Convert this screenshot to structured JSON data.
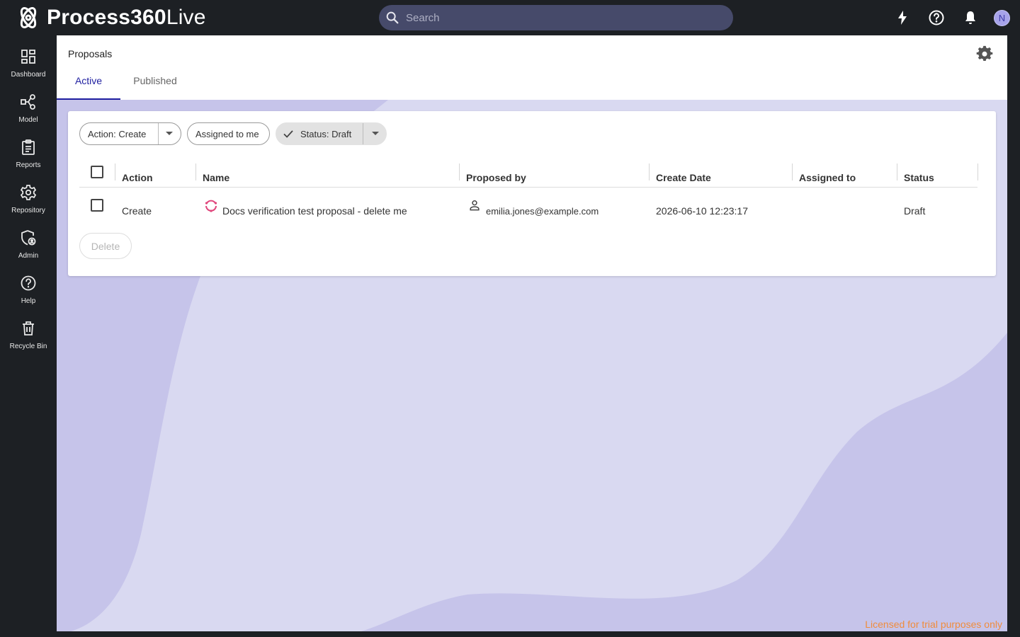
{
  "app": {
    "title_bold": "Process360",
    "title_light": "Live",
    "search_placeholder": "Search",
    "avatar_initial": "N",
    "colors": {
      "accent": "#1f1fa0",
      "topbar": "#1d2024",
      "license": "#f08c3c",
      "background": "#d9d9f1"
    }
  },
  "sidebar": {
    "items": [
      {
        "label": "Dashboard",
        "icon": "dashboard-icon"
      },
      {
        "label": "Model",
        "icon": "model-icon"
      },
      {
        "label": "Reports",
        "icon": "reports-icon"
      },
      {
        "label": "Repository",
        "icon": "repository-icon"
      },
      {
        "label": "Admin",
        "icon": "admin-icon"
      },
      {
        "label": "Help",
        "icon": "help-icon"
      },
      {
        "label": "Recycle Bin",
        "icon": "trash-icon"
      }
    ]
  },
  "page": {
    "title": "Proposals",
    "tabs": [
      {
        "label": "Active",
        "selected": true
      },
      {
        "label": "Published",
        "selected": false
      }
    ]
  },
  "filters": {
    "action": "Action: Create",
    "assigned": "Assigned to me",
    "status": "Status: Draft"
  },
  "table": {
    "columns": [
      "Action",
      "Name",
      "Proposed by",
      "Create Date",
      "Assigned to",
      "Status"
    ],
    "rows": [
      {
        "action": "Create",
        "name": "Docs verification test proposal - delete me",
        "proposed_by": "emilia.jones@example.com",
        "create_date": "2026-06-10 12:23:17",
        "assigned_to": "",
        "status": "Draft"
      }
    ]
  },
  "actions": {
    "delete_label": "Delete"
  },
  "footer": {
    "license_text": "Licensed for trial purposes only"
  }
}
